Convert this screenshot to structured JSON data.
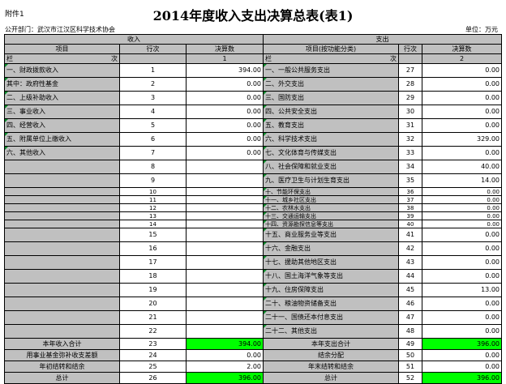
{
  "header": {
    "attachment": "附件1",
    "title": "2014年度收入支出决算总表(表1)",
    "org": "公开部门：武汉市江汉区科学技术协会",
    "unit": "单位：万元"
  },
  "columns": {
    "income_group": "收入",
    "expense_group": "支出",
    "item": "项目",
    "line_no": "行次",
    "amount": "决算数",
    "expense_item": "项目(按功能分类)",
    "row_label_a": "栏",
    "row_label_b": "次",
    "col1": "1",
    "col2": "2"
  },
  "rows": [
    {
      "i_item": "一、财政拨款收入",
      "i_no": "1",
      "i_amt": "394.00",
      "e_item": "一、一般公共服务支出",
      "e_no": "27",
      "e_amt": "0.00"
    },
    {
      "i_item": "其中：政府性基金",
      "i_no": "2",
      "i_amt": "0.00",
      "e_item": "二、外交支出",
      "e_no": "28",
      "e_amt": "0.00"
    },
    {
      "i_item": "二、上级补助收入",
      "i_no": "3",
      "i_amt": "0.00",
      "e_item": "三、国防支出",
      "e_no": "29",
      "e_amt": "0.00"
    },
    {
      "i_item": "三、事业收入",
      "i_no": "4",
      "i_amt": "0.00",
      "e_item": "四、公共安全支出",
      "e_no": "30",
      "e_amt": "0.00"
    },
    {
      "i_item": "四、经营收入",
      "i_no": "5",
      "i_amt": "0.00",
      "e_item": "五、教育支出",
      "e_no": "31",
      "e_amt": "0.00"
    },
    {
      "i_item": "五、附属单位上缴收入",
      "i_no": "6",
      "i_amt": "0.00",
      "e_item": "六、科学技术支出",
      "e_no": "32",
      "e_amt": "329.00"
    },
    {
      "i_item": "六、其他收入",
      "i_no": "7",
      "i_amt": "0.00",
      "e_item": "七、文化体育与传媒支出",
      "e_no": "33",
      "e_amt": "0.00"
    },
    {
      "i_item": "",
      "i_no": "8",
      "i_amt": "",
      "e_item": "八、社会保障和就业支出",
      "e_no": "34",
      "e_amt": "40.00"
    },
    {
      "i_item": "",
      "i_no": "9",
      "i_amt": "",
      "e_item": "九、医疗卫生与计划生育支出",
      "e_no": "35",
      "e_amt": "14.00"
    },
    {
      "i_item": "",
      "i_no": "10",
      "i_amt": "",
      "e_item": "十、节能环保支出",
      "e_no": "36",
      "e_amt": "0.00",
      "tiny": true
    },
    {
      "i_item": "",
      "i_no": "11",
      "i_amt": "",
      "e_item": "十一、城乡社区支出",
      "e_no": "37",
      "e_amt": "0.00",
      "tiny": true
    },
    {
      "i_item": "",
      "i_no": "12",
      "i_amt": "",
      "e_item": "十二、农林水支出",
      "e_no": "38",
      "e_amt": "0.00",
      "tiny": true
    },
    {
      "i_item": "",
      "i_no": "13",
      "i_amt": "",
      "e_item": "十三、交通运输支出",
      "e_no": "39",
      "e_amt": "0.00",
      "tiny": true
    },
    {
      "i_item": "",
      "i_no": "14",
      "i_amt": "",
      "e_item": "十四、资源勘探信息等支出",
      "e_no": "40",
      "e_amt": "0.00",
      "tiny": true
    },
    {
      "i_item": "",
      "i_no": "15",
      "i_amt": "",
      "e_item": "十五、商业服务业等支出",
      "e_no": "41",
      "e_amt": "0.00"
    },
    {
      "i_item": "",
      "i_no": "16",
      "i_amt": "",
      "e_item": "十六、金融支出",
      "e_no": "42",
      "e_amt": "0.00"
    },
    {
      "i_item": "",
      "i_no": "17",
      "i_amt": "",
      "e_item": "十七、援助其他地区支出",
      "e_no": "43",
      "e_amt": "0.00"
    },
    {
      "i_item": "",
      "i_no": "18",
      "i_amt": "",
      "e_item": "十八、国土海洋气象等支出",
      "e_no": "44",
      "e_amt": "0.00"
    },
    {
      "i_item": "",
      "i_no": "19",
      "i_amt": "",
      "e_item": "十九、住房保障支出",
      "e_no": "45",
      "e_amt": "13.00"
    },
    {
      "i_item": "",
      "i_no": "20",
      "i_amt": "",
      "e_item": "二十、粮油物资储备支出",
      "e_no": "46",
      "e_amt": "0.00"
    },
    {
      "i_item": "",
      "i_no": "21",
      "i_amt": "",
      "e_item": "二十一、国债还本付息支出",
      "e_no": "47",
      "e_amt": "0.00"
    },
    {
      "i_item": "",
      "i_no": "22",
      "i_amt": "",
      "e_item": "二十二、其他支出",
      "e_no": "48",
      "e_amt": "0.00"
    }
  ],
  "totals": [
    {
      "i_item": "本年收入合计",
      "i_no": "23",
      "i_amt": "394.00",
      "i_green": true,
      "e_item": "本年支出合计",
      "e_no": "49",
      "e_amt": "396.00",
      "e_green": true
    },
    {
      "i_item": "用事业基金弥补收支差额",
      "i_no": "24",
      "i_amt": "0.00",
      "e_item": "结余分配",
      "e_no": "50",
      "e_amt": "0.00"
    },
    {
      "i_item": "年初结转和结余",
      "i_no": "25",
      "i_amt": "2.00",
      "e_item": "年末结转和结余",
      "e_no": "51",
      "e_amt": "0.00"
    },
    {
      "i_item": "总计",
      "i_no": "26",
      "i_amt": "396.00",
      "i_green": true,
      "e_item": "总计",
      "e_no": "52",
      "e_amt": "396.00",
      "e_green": true
    }
  ]
}
